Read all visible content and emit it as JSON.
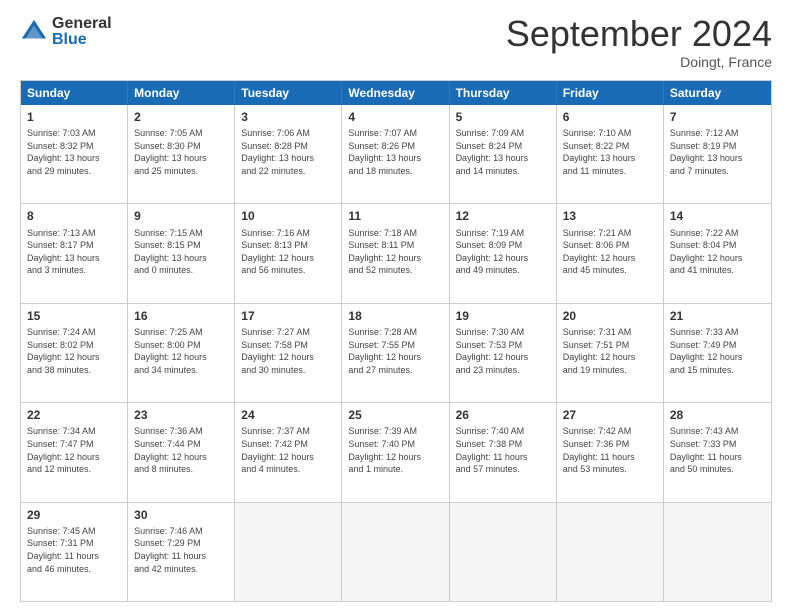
{
  "header": {
    "logo_general": "General",
    "logo_blue": "Blue",
    "month_title": "September 2024",
    "subtitle": "Doingt, France"
  },
  "calendar": {
    "weekdays": [
      "Sunday",
      "Monday",
      "Tuesday",
      "Wednesday",
      "Thursday",
      "Friday",
      "Saturday"
    ],
    "rows": [
      [
        {
          "day": "1",
          "text": "Sunrise: 7:03 AM\nSunset: 8:32 PM\nDaylight: 13 hours\nand 29 minutes."
        },
        {
          "day": "2",
          "text": "Sunrise: 7:05 AM\nSunset: 8:30 PM\nDaylight: 13 hours\nand 25 minutes."
        },
        {
          "day": "3",
          "text": "Sunrise: 7:06 AM\nSunset: 8:28 PM\nDaylight: 13 hours\nand 22 minutes."
        },
        {
          "day": "4",
          "text": "Sunrise: 7:07 AM\nSunset: 8:26 PM\nDaylight: 13 hours\nand 18 minutes."
        },
        {
          "day": "5",
          "text": "Sunrise: 7:09 AM\nSunset: 8:24 PM\nDaylight: 13 hours\nand 14 minutes."
        },
        {
          "day": "6",
          "text": "Sunrise: 7:10 AM\nSunset: 8:22 PM\nDaylight: 13 hours\nand 11 minutes."
        },
        {
          "day": "7",
          "text": "Sunrise: 7:12 AM\nSunset: 8:19 PM\nDaylight: 13 hours\nand 7 minutes."
        }
      ],
      [
        {
          "day": "8",
          "text": "Sunrise: 7:13 AM\nSunset: 8:17 PM\nDaylight: 13 hours\nand 3 minutes."
        },
        {
          "day": "9",
          "text": "Sunrise: 7:15 AM\nSunset: 8:15 PM\nDaylight: 13 hours\nand 0 minutes."
        },
        {
          "day": "10",
          "text": "Sunrise: 7:16 AM\nSunset: 8:13 PM\nDaylight: 12 hours\nand 56 minutes."
        },
        {
          "day": "11",
          "text": "Sunrise: 7:18 AM\nSunset: 8:11 PM\nDaylight: 12 hours\nand 52 minutes."
        },
        {
          "day": "12",
          "text": "Sunrise: 7:19 AM\nSunset: 8:09 PM\nDaylight: 12 hours\nand 49 minutes."
        },
        {
          "day": "13",
          "text": "Sunrise: 7:21 AM\nSunset: 8:06 PM\nDaylight: 12 hours\nand 45 minutes."
        },
        {
          "day": "14",
          "text": "Sunrise: 7:22 AM\nSunset: 8:04 PM\nDaylight: 12 hours\nand 41 minutes."
        }
      ],
      [
        {
          "day": "15",
          "text": "Sunrise: 7:24 AM\nSunset: 8:02 PM\nDaylight: 12 hours\nand 38 minutes."
        },
        {
          "day": "16",
          "text": "Sunrise: 7:25 AM\nSunset: 8:00 PM\nDaylight: 12 hours\nand 34 minutes."
        },
        {
          "day": "17",
          "text": "Sunrise: 7:27 AM\nSunset: 7:58 PM\nDaylight: 12 hours\nand 30 minutes."
        },
        {
          "day": "18",
          "text": "Sunrise: 7:28 AM\nSunset: 7:55 PM\nDaylight: 12 hours\nand 27 minutes."
        },
        {
          "day": "19",
          "text": "Sunrise: 7:30 AM\nSunset: 7:53 PM\nDaylight: 12 hours\nand 23 minutes."
        },
        {
          "day": "20",
          "text": "Sunrise: 7:31 AM\nSunset: 7:51 PM\nDaylight: 12 hours\nand 19 minutes."
        },
        {
          "day": "21",
          "text": "Sunrise: 7:33 AM\nSunset: 7:49 PM\nDaylight: 12 hours\nand 15 minutes."
        }
      ],
      [
        {
          "day": "22",
          "text": "Sunrise: 7:34 AM\nSunset: 7:47 PM\nDaylight: 12 hours\nand 12 minutes."
        },
        {
          "day": "23",
          "text": "Sunrise: 7:36 AM\nSunset: 7:44 PM\nDaylight: 12 hours\nand 8 minutes."
        },
        {
          "day": "24",
          "text": "Sunrise: 7:37 AM\nSunset: 7:42 PM\nDaylight: 12 hours\nand 4 minutes."
        },
        {
          "day": "25",
          "text": "Sunrise: 7:39 AM\nSunset: 7:40 PM\nDaylight: 12 hours\nand 1 minute."
        },
        {
          "day": "26",
          "text": "Sunrise: 7:40 AM\nSunset: 7:38 PM\nDaylight: 11 hours\nand 57 minutes."
        },
        {
          "day": "27",
          "text": "Sunrise: 7:42 AM\nSunset: 7:36 PM\nDaylight: 11 hours\nand 53 minutes."
        },
        {
          "day": "28",
          "text": "Sunrise: 7:43 AM\nSunset: 7:33 PM\nDaylight: 11 hours\nand 50 minutes."
        }
      ],
      [
        {
          "day": "29",
          "text": "Sunrise: 7:45 AM\nSunset: 7:31 PM\nDaylight: 11 hours\nand 46 minutes."
        },
        {
          "day": "30",
          "text": "Sunrise: 7:46 AM\nSunset: 7:29 PM\nDaylight: 11 hours\nand 42 minutes."
        },
        {
          "day": "",
          "text": ""
        },
        {
          "day": "",
          "text": ""
        },
        {
          "day": "",
          "text": ""
        },
        {
          "day": "",
          "text": ""
        },
        {
          "day": "",
          "text": ""
        }
      ]
    ]
  }
}
